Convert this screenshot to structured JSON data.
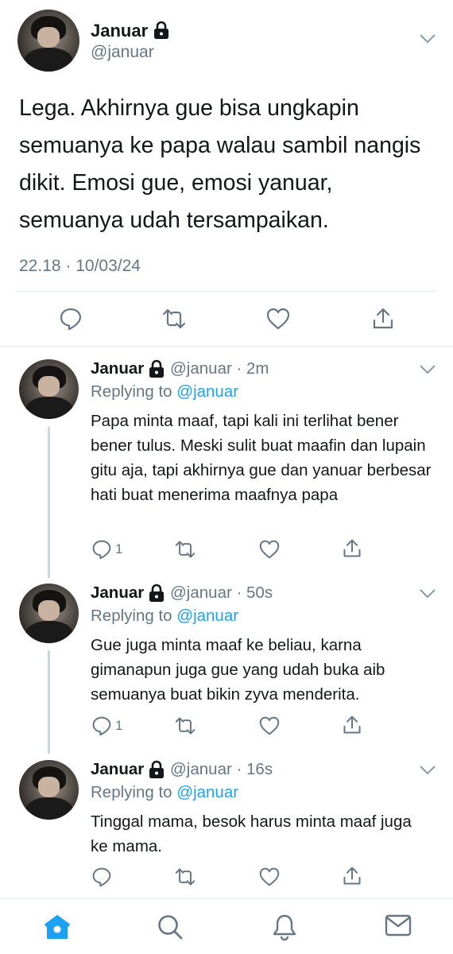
{
  "main_tweet": {
    "name": "Januar",
    "handle": "@januar",
    "text": "Lega. Akhirnya gue bisa ungkapin semuanya ke papa walau sambil nangis dikit. Emosi gue, emosi yanuar, semuanya udah tersampaikan.",
    "timestamp": "22.18 · 10/03/24",
    "actions": [
      "reply-icon",
      "retweet-icon",
      "like-icon",
      "share-icon"
    ]
  },
  "replies": [
    {
      "name": "Januar",
      "handle": "@januar · 2m",
      "replying_prefix": "Replying to ",
      "replying_to": "@januar",
      "text": "Papa minta maaf, tapi kali ini terlihat bener bener tulus. Meski sulit buat maafin dan lupain gitu aja, tapi akhirnya gue dan yanuar berbesar hati buat menerima maafnya papa",
      "reply_count": "1"
    },
    {
      "name": "Januar",
      "handle": "@januar · 50s",
      "replying_prefix": "Replying to ",
      "replying_to": "@januar",
      "text": "Gue juga minta maaf ke beliau, karna gimanapun juga gue yang udah buka aib semuanya buat bikin zyva menderita.",
      "reply_count": "1"
    },
    {
      "name": "Januar",
      "handle": "@januar · 16s",
      "replying_prefix": "Replying to ",
      "replying_to": "@januar",
      "text": "Tinggal mama, besok harus minta maaf juga ke mama.",
      "reply_count": ""
    }
  ],
  "bottom_nav": [
    "home-icon",
    "search-icon",
    "notifications-icon",
    "messages-icon"
  ],
  "colors": {
    "accent": "#1da1f2",
    "secondary_text": "#657786",
    "divider": "#e1e8ed"
  }
}
